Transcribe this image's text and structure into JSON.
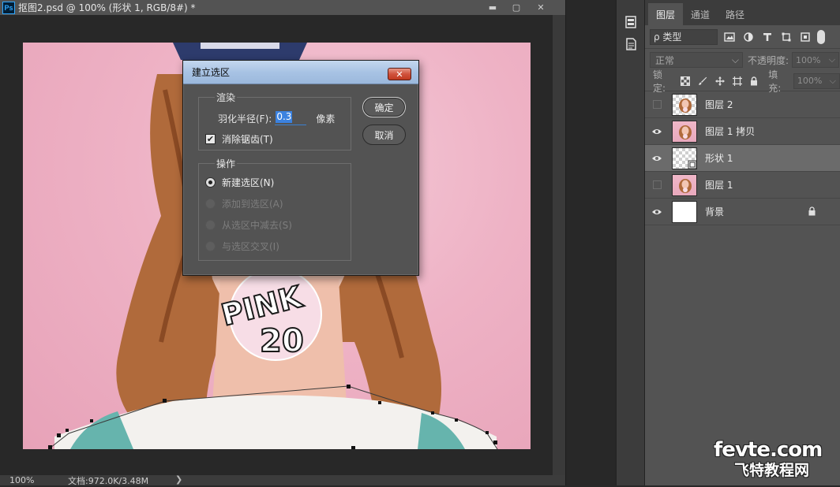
{
  "document": {
    "title": "抠图2.psd @ 100% (形状 1, RGB/8#) *",
    "app_icon_text": "Ps",
    "min_glyph": "▬",
    "max_glyph": "▢",
    "close_glyph": "✕",
    "status": {
      "zoom": "100%",
      "doc_info": "文档:972.0K/3.48M",
      "arrow": "❯"
    }
  },
  "canvas": {
    "image_text_1": "PINK",
    "image_text_2": "20"
  },
  "layers_panel": {
    "tabs": [
      {
        "label": "图层"
      },
      {
        "label": "通道"
      },
      {
        "label": "路径"
      }
    ],
    "filter": {
      "kind_label": "ρ 类型"
    },
    "blend_mode": "正常",
    "opacity_label": "不透明度:",
    "opacity_value": "100%",
    "lock_label": "锁定:",
    "fill_label": "填充:",
    "fill_value": "100%",
    "layers": [
      {
        "name": "图层 2",
        "visible": false
      },
      {
        "name": "图层 1 拷贝",
        "visible": true
      },
      {
        "name": "形状 1",
        "visible": true,
        "selected": true
      },
      {
        "name": "图层 1",
        "visible": false
      },
      {
        "name": "背景",
        "visible": true,
        "locked": true
      }
    ]
  },
  "dialog": {
    "title": "建立选区",
    "close_glyph": "✕",
    "render_group": {
      "label": "渲染",
      "feather_label": "羽化半径(F):",
      "feather_value": "0.3",
      "feather_unit": "像素",
      "antialias_label": "消除锯齿(T)",
      "antialias_checked": true
    },
    "ops_group": {
      "label": "操作",
      "options": [
        {
          "label": "新建选区(N)",
          "selected": true,
          "enabled": true
        },
        {
          "label": "添加到选区(A)",
          "selected": false,
          "enabled": false
        },
        {
          "label": "从选区中减去(S)",
          "selected": false,
          "enabled": false
        },
        {
          "label": "与选区交叉(I)",
          "selected": false,
          "enabled": false
        }
      ]
    },
    "ok_label": "确定",
    "cancel_label": "取消"
  },
  "watermark": {
    "top": "fevte.com",
    "bottom": "飞特教程网"
  },
  "colors": {
    "canvas_pink": "#eeb2c5",
    "panel_bg": "#535353",
    "selected_layer": "#6b6b6b",
    "highlight": "#3b82e0"
  }
}
